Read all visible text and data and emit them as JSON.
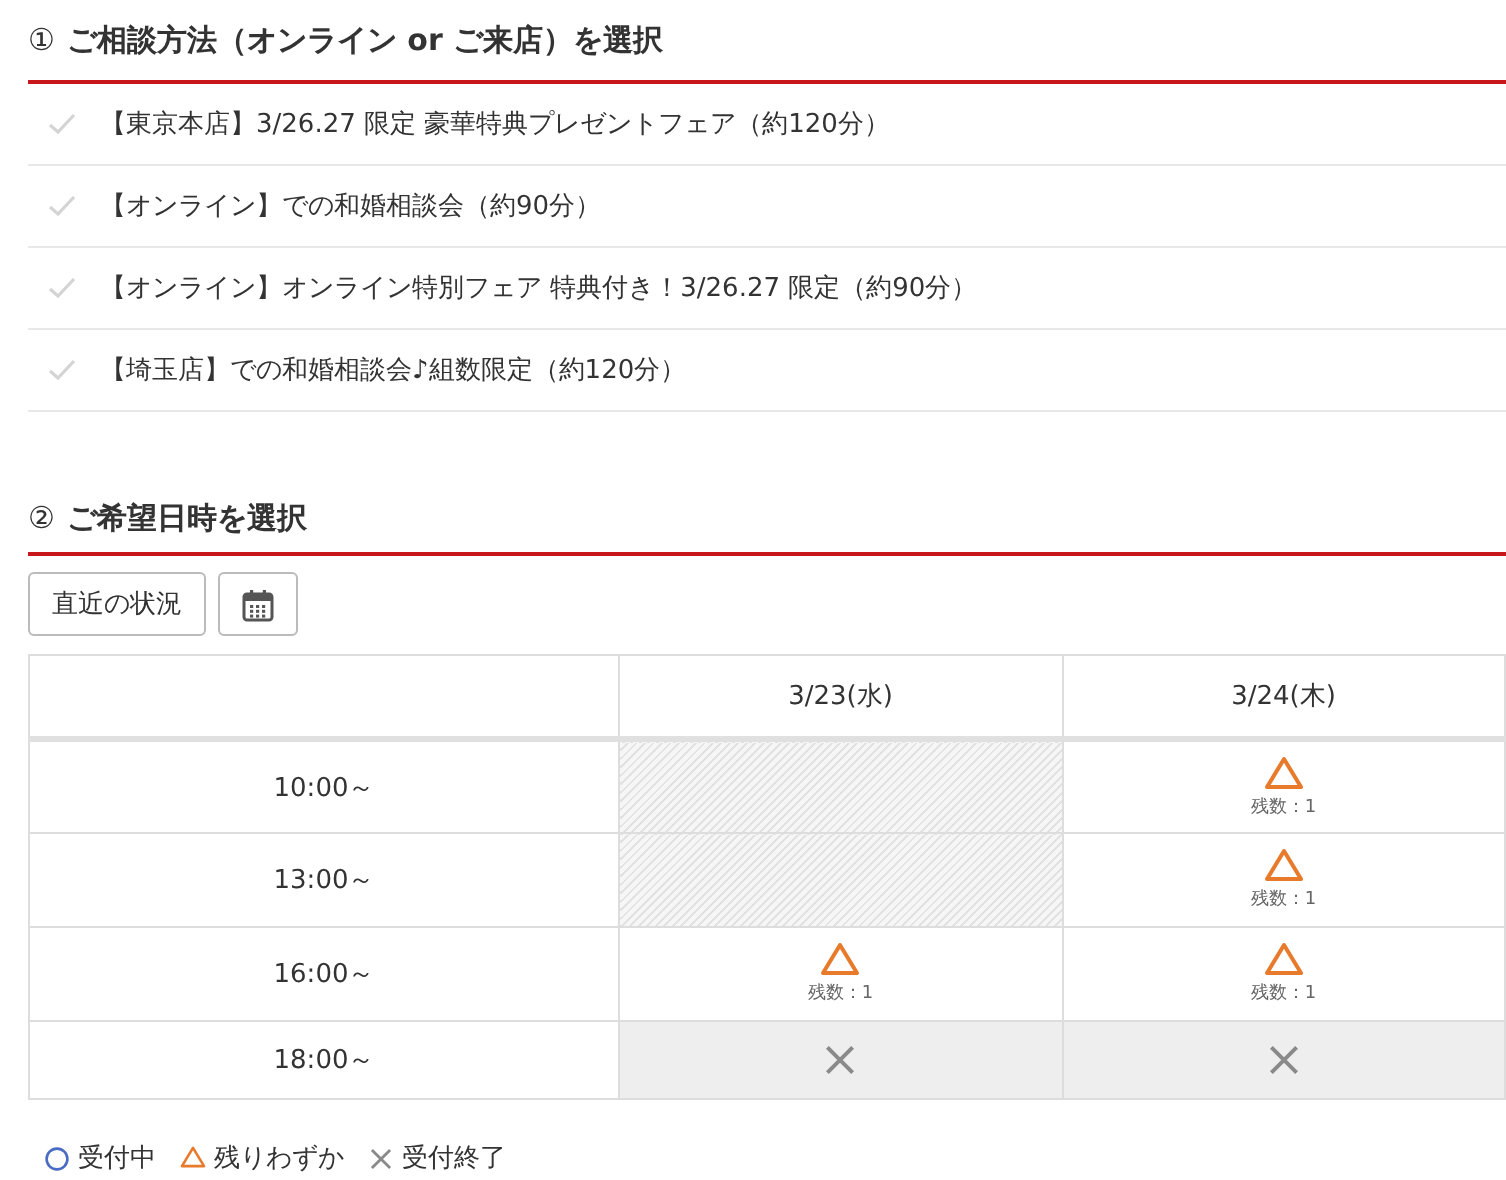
{
  "section1": {
    "number": "①",
    "title": "ご相談方法（オンライン or ご来店）を選択"
  },
  "plans": [
    {
      "label": "【東京本店】3/26.27 限定 豪華特典プレゼントフェア（約120分）"
    },
    {
      "label": "【オンライン】での和婚相談会（約90分）"
    },
    {
      "label": "【オンライン】オンライン特別フェア 特典付き！3/26.27 限定（約90分）"
    },
    {
      "label": "【埼玉店】での和婚相談会♪組数限定（約120分）"
    }
  ],
  "section2": {
    "number": "②",
    "title": "ご希望日時を選択"
  },
  "recent_button": "直近の状況",
  "table": {
    "columns": [
      "3/23(水)",
      "3/24(木)"
    ],
    "rows": [
      {
        "time": "10:00～",
        "cells": [
          {
            "kind": "unavailable"
          },
          {
            "kind": "few",
            "remaining": "残数：1"
          }
        ]
      },
      {
        "time": "13:00～",
        "cells": [
          {
            "kind": "unavailable"
          },
          {
            "kind": "few",
            "remaining": "残数：1"
          }
        ]
      },
      {
        "time": "16:00～",
        "cells": [
          {
            "kind": "few",
            "remaining": "残数：1"
          },
          {
            "kind": "few",
            "remaining": "残数：1"
          }
        ]
      },
      {
        "time": "18:00～",
        "cells": [
          {
            "kind": "closed"
          },
          {
            "kind": "closed"
          }
        ]
      }
    ]
  },
  "legend": [
    {
      "kind": "open",
      "label": "受付中"
    },
    {
      "kind": "few",
      "label": "残りわずか"
    },
    {
      "kind": "closed",
      "label": "受付終了"
    }
  ]
}
